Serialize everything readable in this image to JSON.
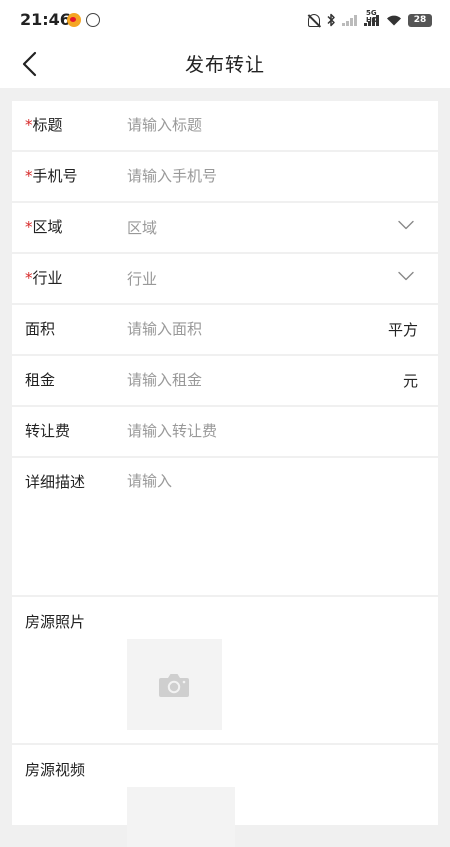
{
  "status_bar": {
    "time": "21:46",
    "net_type": "5G HD",
    "battery": "28"
  },
  "nav": {
    "title": "发布转让"
  },
  "form": {
    "required_mark": "*",
    "title_field": {
      "label": "标题",
      "placeholder": "请输入标题"
    },
    "phone_field": {
      "label": "手机号",
      "placeholder": "请输入手机号"
    },
    "region_field": {
      "label": "区域",
      "value": "区域"
    },
    "industry_field": {
      "label": "行业",
      "value": "行业"
    },
    "area_field": {
      "label": "面积",
      "placeholder": "请输入面积",
      "unit": "平方"
    },
    "rent_field": {
      "label": "租金",
      "placeholder": "请输入租金",
      "unit": "元"
    },
    "transfer_fee_field": {
      "label": "转让费",
      "placeholder": "请输入转让费"
    },
    "description_field": {
      "label": "详细描述",
      "placeholder": "请输入"
    },
    "photos": {
      "label": "房源照片",
      "icon": "camera-icon"
    },
    "videos": {
      "label": "房源视频"
    }
  },
  "colors": {
    "required": "#d62b2b",
    "placeholder": "#999999",
    "background": "#f0f0f0",
    "card": "#ffffff"
  }
}
